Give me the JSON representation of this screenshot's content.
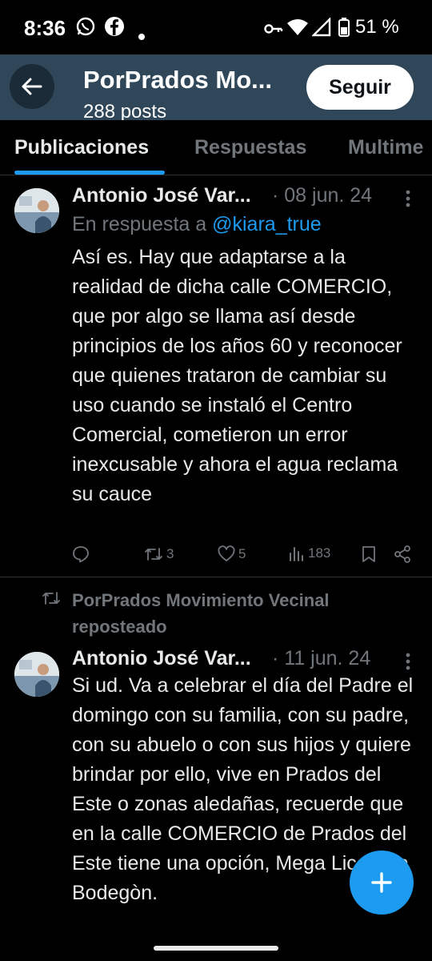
{
  "status_bar": {
    "time": "8:36",
    "battery": "51 %"
  },
  "header": {
    "title": "PorPrados Mo...",
    "posts_count": "288 posts",
    "follow_label": "Seguir"
  },
  "tabs": [
    {
      "label": "Publicaciones",
      "active": true
    },
    {
      "label": "Respuestas",
      "active": false
    },
    {
      "label": "Multime",
      "active": false
    }
  ],
  "posts": [
    {
      "author": "Antonio José Var...",
      "date": "· 08 jun. 24",
      "reply_prefix": "En respuesta a ",
      "reply_handle": "@kiara_true",
      "text": "Así es. Hay que adaptarse a la realidad de dicha calle COMERCIO, que por algo se llama así desde principios de los años 60 y reconocer que quienes trataron de cambiar su uso cuando se instaló el Centro Comercial, cometieron un error inexcusable y ahora el agua reclama su cauce",
      "retweets": "3",
      "likes": "5",
      "views": "183"
    },
    {
      "repost_label": "PorPrados Movimiento Vecinal reposteado",
      "author": "Antonio José Var...",
      "date": "· 11 jun. 24",
      "text": "Si ud. Va a celebrar el día del Padre el domingo con su familia, con su padre, con su abuelo o con sus hijos y quiere brindar por ello, vive en Prados del Este o zonas aledañas, recuerde que en la calle COMERCIO de Prados del Este tiene una opción, Mega Licorería Bodegòn."
    }
  ],
  "colors": {
    "accent": "#1d9bf0",
    "header_bg": "#2f4758",
    "muted": "#71767b"
  }
}
